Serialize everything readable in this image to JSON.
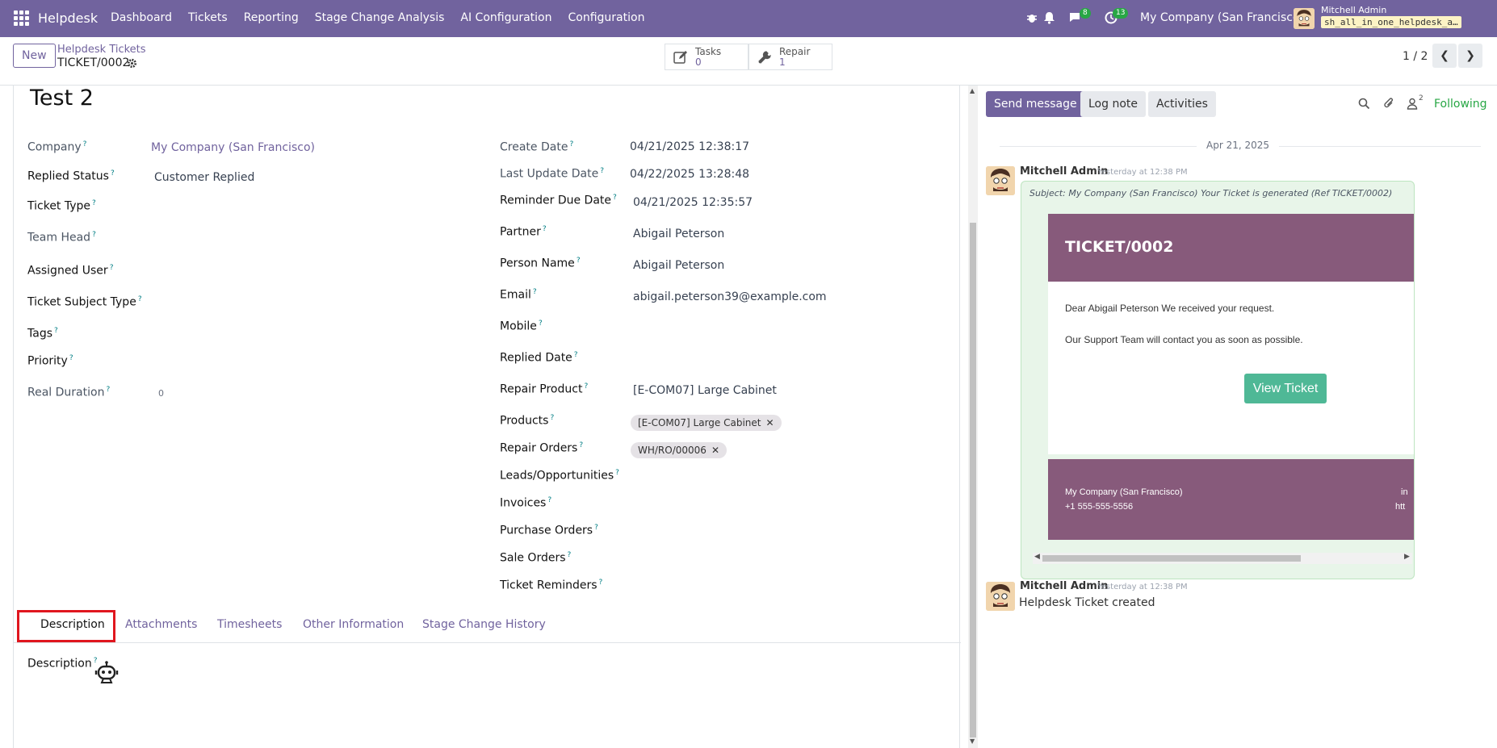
{
  "navbar": {
    "app_name": "Helpdesk",
    "menu": [
      "Dashboard",
      "Tickets",
      "Reporting",
      "Stage Change Analysis",
      "AI Configuration",
      "Configuration"
    ],
    "messages_count": "8",
    "activities_count": "13",
    "company": "My Company (San Francisco)",
    "user_name": "Mitchell Admin",
    "database": "sh_all_in_one_helpdesk_a…"
  },
  "control": {
    "new_label": "New",
    "breadcrumb_parent": "Helpdesk Tickets",
    "breadcrumb_current": "TICKET/0002",
    "smart_buttons": [
      {
        "label": "Tasks",
        "value": "0",
        "icon": "edit-icon"
      },
      {
        "label": "Repair",
        "value": "1",
        "icon": "wrench-icon"
      }
    ],
    "pager": "1 / 2"
  },
  "form": {
    "title": "Test 2",
    "left": {
      "company_label": "Company",
      "company_value": "My Company (San Francisco)",
      "replied_status_label": "Replied Status",
      "replied_status_value": "Customer Replied",
      "ticket_type_label": "Ticket Type",
      "team_head_label": "Team Head",
      "assigned_user_label": "Assigned User",
      "ticket_subject_type_label": "Ticket Subject Type",
      "tags_label": "Tags",
      "priority_label": "Priority",
      "real_duration_label": "Real Duration",
      "real_duration_value": "0"
    },
    "right": {
      "create_date_label": "Create Date",
      "create_date_value": "04/21/2025 12:38:17",
      "last_update_label": "Last Update Date",
      "last_update_value": "04/22/2025 13:28:48",
      "reminder_due_label": "Reminder Due Date",
      "reminder_due_value": "04/21/2025 12:35:57",
      "partner_label": "Partner",
      "partner_value": "Abigail Peterson",
      "person_name_label": "Person Name",
      "person_name_value": "Abigail Peterson",
      "email_label": "Email",
      "email_value": "abigail.peterson39@example.com",
      "mobile_label": "Mobile",
      "replied_date_label": "Replied Date",
      "repair_product_label": "Repair Product",
      "repair_product_value": "[E-COM07] Large Cabinet",
      "products_label": "Products",
      "products_tag": "[E-COM07] Large Cabinet",
      "repair_orders_label": "Repair Orders",
      "repair_orders_tag": "WH/RO/00006",
      "leads_label": "Leads/Opportunities",
      "invoices_label": "Invoices",
      "purchase_orders_label": "Purchase Orders",
      "sale_orders_label": "Sale Orders",
      "ticket_reminders_label": "Ticket Reminders"
    },
    "tabs": [
      "Description",
      "Attachments",
      "Timesheets",
      "Other Information",
      "Stage Change History"
    ],
    "description_label": "Description"
  },
  "chatter": {
    "send_message": "Send message",
    "log_note": "Log note",
    "activities": "Activities",
    "followers_count": "2",
    "following": "Following",
    "date_separator": "Apr 21, 2025",
    "messages": [
      {
        "author": "Mitchell Admin",
        "when": "Yesterday at 12:38 PM",
        "subject": "Subject: My Company (San Francisco) Your Ticket is generated (Ref TICKET/0002)",
        "mail_heading": "TICKET/0002",
        "mail_line1": "Dear Abigail Peterson We received your request.",
        "mail_line2": "Our Support Team will contact you as soon as possible.",
        "button": "View Ticket",
        "footer_company": "My Company (San Francisco)",
        "footer_phone": "+1 555-555-5556",
        "footer_right1": "in",
        "footer_right2": "htt"
      },
      {
        "author": "Mitchell Admin",
        "when": "Yesterday at 12:38 PM",
        "body": "Helpdesk Ticket created"
      }
    ]
  }
}
